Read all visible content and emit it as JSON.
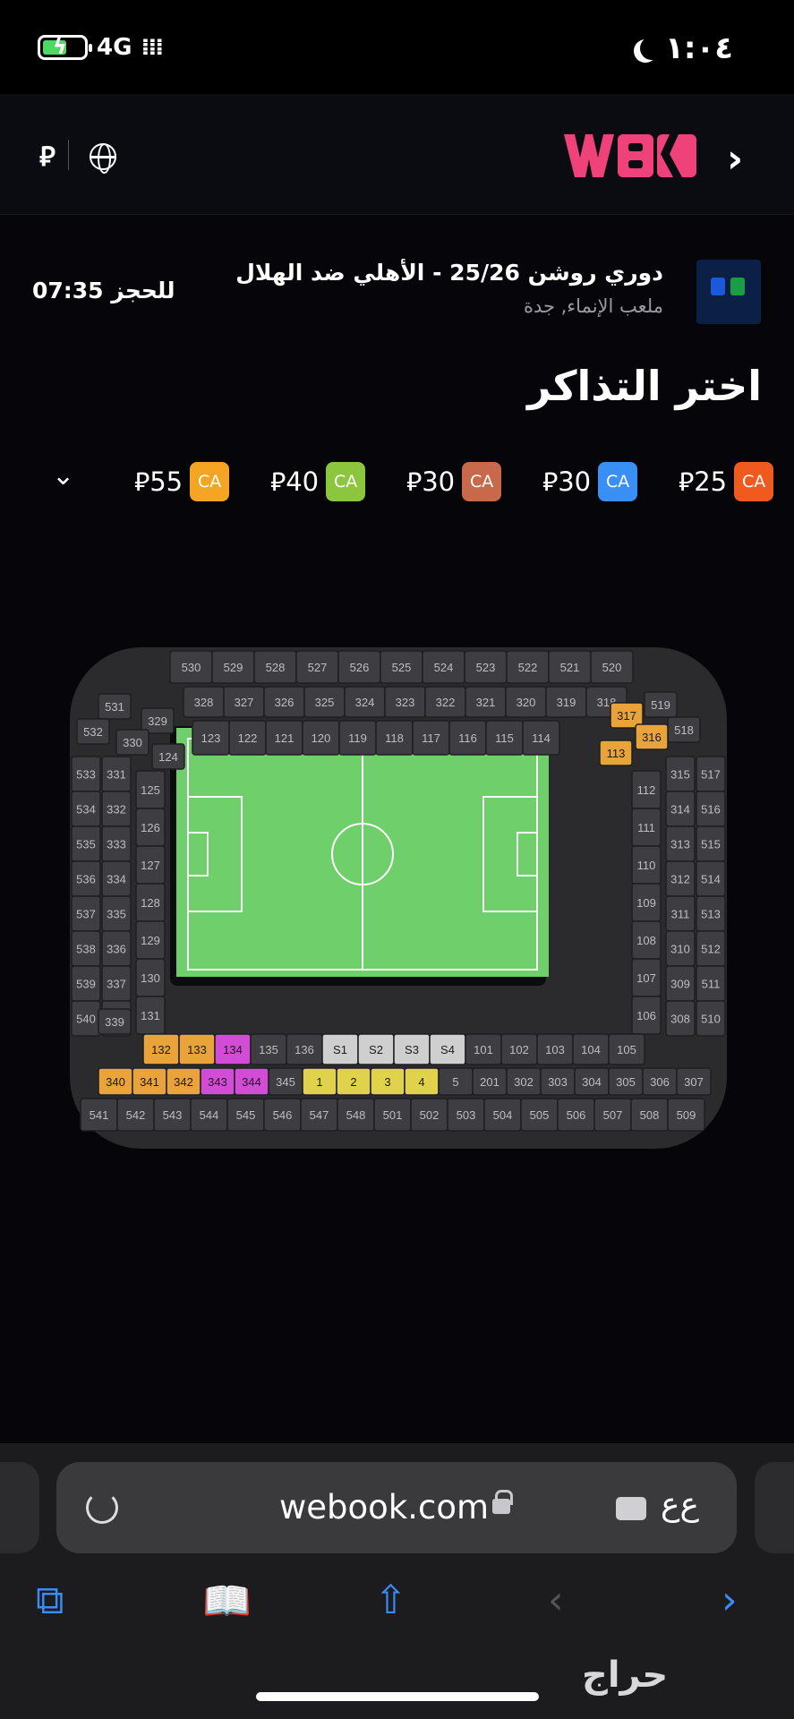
{
  "status_bar": {
    "network": "4G",
    "time": "١:٠٤"
  },
  "header": {
    "brand": "WBK",
    "currency_symbol": "⃁"
  },
  "event": {
    "title": "دوري روشن 25/26 - الأهلي ضد الهلال",
    "venue": "ملعب الإنماء, جدة",
    "timer": "07:35 للحجز"
  },
  "page_title": "اختر التذاكر",
  "prices": [
    {
      "label": "CA",
      "amount": "25",
      "color": "#f05a1e"
    },
    {
      "label": "CA",
      "amount": "30",
      "color": "#3a8ff5"
    },
    {
      "label": "CA",
      "amount": "30",
      "color": "#c8694c"
    },
    {
      "label": "CA",
      "amount": "40",
      "color": "#8cc63e"
    },
    {
      "label": "CA",
      "amount": "55",
      "color": "#f5a524"
    }
  ],
  "stadium": {
    "pitch_color": "#6fcf6a",
    "available_colors": {
      "orange": "#e8a33a",
      "magenta": "#d24cd6",
      "yellow": "#e0d24a",
      "silver": "#cfcfcf"
    },
    "top_outer": [
      "530",
      "529",
      "528",
      "527",
      "526",
      "525",
      "524",
      "523",
      "522",
      "521",
      "520"
    ],
    "top_middle": [
      "328",
      "327",
      "326",
      "325",
      "324",
      "323",
      "322",
      "321",
      "320",
      "319",
      "318"
    ],
    "top_inner": [
      "123",
      "122",
      "121",
      "120",
      "119",
      "118",
      "117",
      "116",
      "115",
      "114"
    ],
    "left_outer": [
      "533",
      "534",
      "535",
      "536",
      "537",
      "538",
      "539",
      "540"
    ],
    "left_middle": [
      "331",
      "332",
      "333",
      "334",
      "335",
      "336",
      "337",
      "338"
    ],
    "left_inner": [
      "125",
      "126",
      "127",
      "128",
      "129",
      "130",
      "131"
    ],
    "right_outer": [
      "517",
      "516",
      "515",
      "514",
      "513",
      "512",
      "511",
      "510"
    ],
    "right_middle": [
      "315",
      "314",
      "313",
      "312",
      "311",
      "310",
      "309",
      "308"
    ],
    "right_inner": [
      "112",
      "111",
      "110",
      "109",
      "108",
      "107",
      "106"
    ],
    "bottom_inner": [
      "132",
      "133",
      "134",
      "135",
      "136",
      "S1",
      "S2",
      "S3",
      "S4",
      "101",
      "102",
      "103",
      "104",
      "105"
    ],
    "bottom_middle": [
      "340",
      "341",
      "342",
      "343",
      "344",
      "345",
      "1",
      "2",
      "3",
      "4",
      "5",
      "201",
      "302",
      "303",
      "304",
      "305",
      "306",
      "307"
    ],
    "bottom_outer": [
      "541",
      "542",
      "543",
      "544",
      "545",
      "546",
      "547",
      "548",
      "501",
      "502",
      "503",
      "504",
      "505",
      "506",
      "507",
      "508",
      "509"
    ],
    "corner_labels": [
      "531",
      "532",
      "329",
      "330",
      "124",
      "519",
      "518",
      "317",
      "316",
      "113",
      "339"
    ]
  },
  "browser": {
    "url": "webook.com",
    "aa_label": "ع‌ع"
  },
  "watermark": "حراج"
}
